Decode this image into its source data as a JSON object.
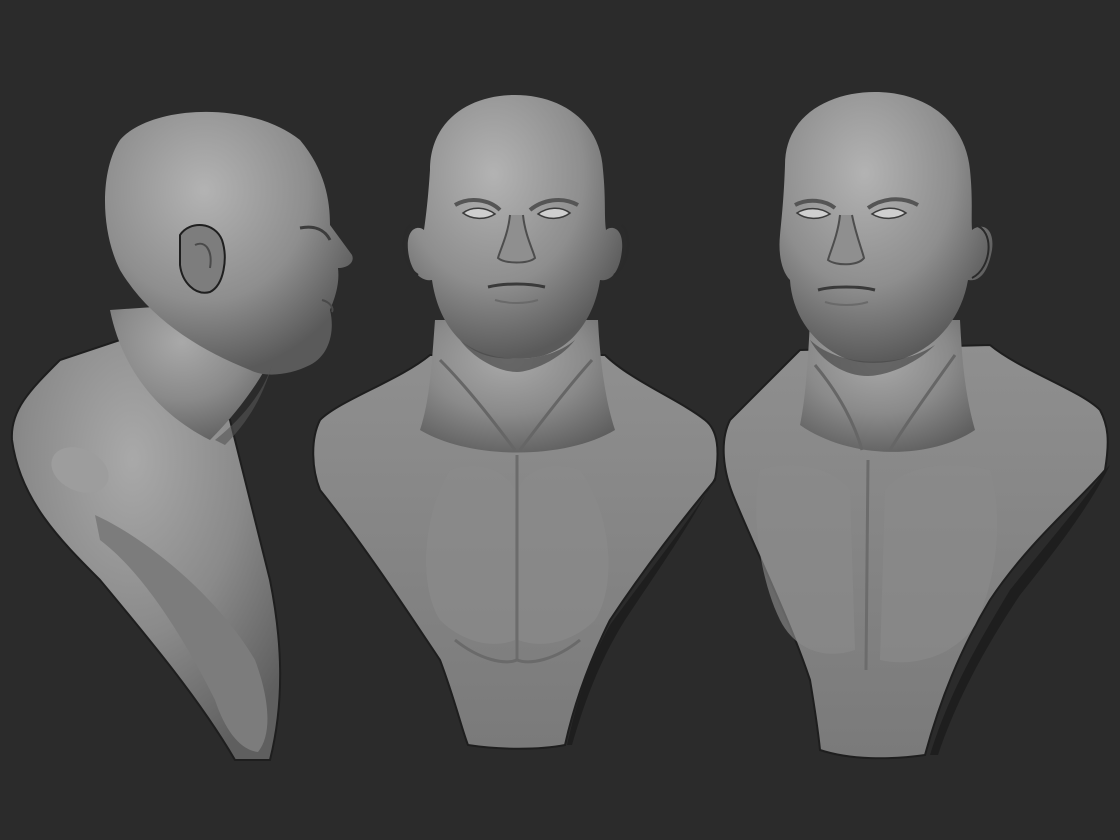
{
  "scene": {
    "background_color": "#2b2b2b",
    "material_color": "#8c8c8c",
    "views": [
      {
        "id": "side",
        "icon": "bust-side-view-icon"
      },
      {
        "id": "front",
        "icon": "bust-front-view-icon"
      },
      {
        "id": "three-quarter",
        "icon": "bust-three-quarter-view-icon"
      }
    ]
  }
}
